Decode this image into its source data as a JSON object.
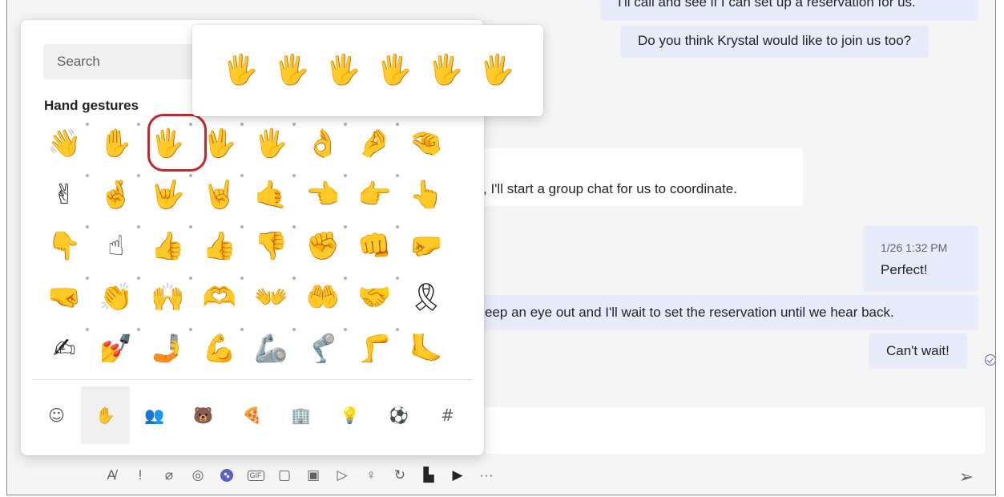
{
  "chat": {
    "messages": [
      {
        "side": "mine",
        "text": "I'll call and see if I can set up a reservation for us."
      },
      {
        "side": "mine",
        "text": "Do you think Krystal would like to join us too?"
      },
      {
        "side": "theirs",
        "text": ", I'll start a group chat for us to coordinate."
      },
      {
        "side": "mine",
        "timestamp": "1/26 1:32 PM",
        "text": "Perfect!"
      },
      {
        "side": "mine",
        "text": "eep an eye out and I'll wait to set the reservation until we hear back."
      },
      {
        "side": "mine",
        "text": "Can't wait!"
      }
    ]
  },
  "emoji_panel": {
    "search_placeholder": "Search",
    "section_title": "Hand gestures",
    "emojis": [
      "👋",
      "✋",
      "🖐",
      "🖖",
      "🖐",
      "👌",
      "🤌",
      "🤏",
      "✌",
      "🤞",
      "🤟",
      "🤘",
      "🤙",
      "👈",
      "👉",
      "👆",
      "👇",
      "☝",
      "👍",
      "👍",
      "👎",
      "✊",
      "👊",
      "🤛",
      "🤜",
      "👏",
      "🙌",
      "🫶",
      "👐",
      "🤲",
      "🤝",
      "🎗",
      "✍",
      "💅",
      "🤳",
      "💪",
      "🦾",
      "🦿",
      "🦵",
      "🦶"
    ],
    "categories": [
      {
        "icon": "☺",
        "name": "smileys"
      },
      {
        "icon": "✋",
        "name": "hand-gestures",
        "active": true
      },
      {
        "icon": "👥",
        "name": "people"
      },
      {
        "icon": "🐻",
        "name": "animals"
      },
      {
        "icon": "🍕",
        "name": "food"
      },
      {
        "icon": "🏢",
        "name": "travel-places"
      },
      {
        "icon": "💡",
        "name": "objects"
      },
      {
        "icon": "⚽",
        "name": "activities"
      },
      {
        "icon": "#",
        "name": "symbols"
      }
    ]
  },
  "skin_tones": [
    {
      "emoji": "🖐",
      "color": "#ffc83d"
    },
    {
      "emoji": "🖐",
      "color": "#f7dece"
    },
    {
      "emoji": "🖐",
      "color": "#f3d2a2"
    },
    {
      "emoji": "🖐",
      "color": "#d5ab88"
    },
    {
      "emoji": "🖐",
      "color": "#af7e57"
    },
    {
      "emoji": "🖐",
      "color": "#7c533e"
    }
  ],
  "toolbar": {
    "icons": [
      "format-icon",
      "priority-icon",
      "attach-icon",
      "loop-icon",
      "emoji-icon",
      "gif-icon",
      "sticker-icon",
      "schedule-meeting-icon",
      "stream-icon",
      "praise-icon",
      "updates-icon",
      "apps-icon",
      "video-icon",
      "more-icon"
    ],
    "gif_label": "GIF",
    "more_label": "···"
  },
  "colors": {
    "accent": "#5b5fc7",
    "highlight_ring": "#c4282d",
    "my_bubble": "#e8ebfa"
  }
}
